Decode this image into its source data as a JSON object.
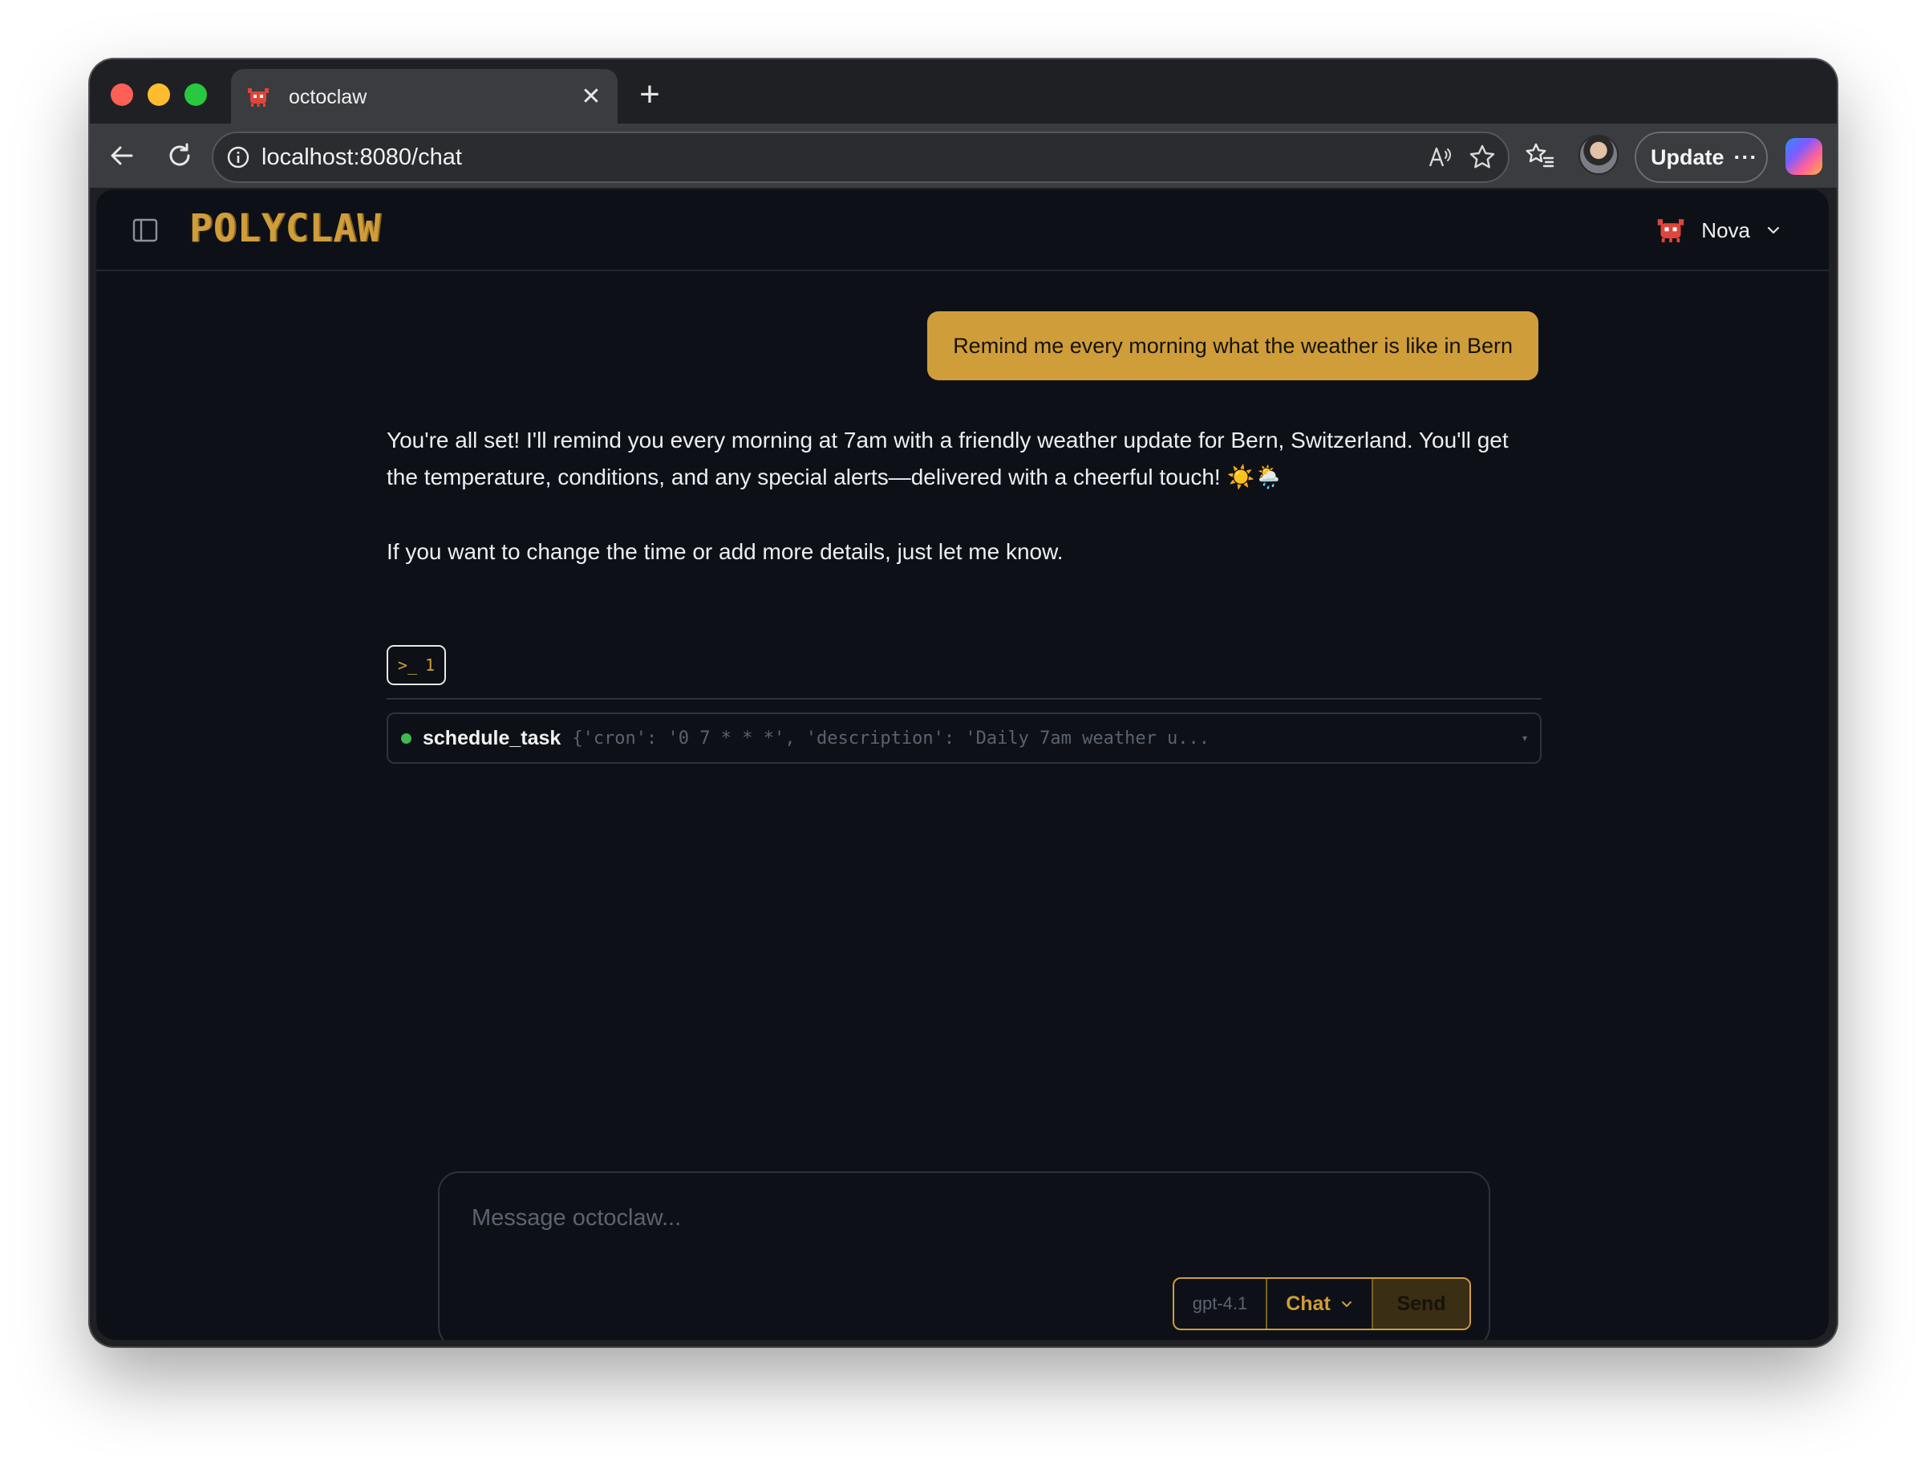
{
  "browser": {
    "tab_title": "octoclaw",
    "url": "localhost:8080/chat",
    "update_label": "Update",
    "icons": [
      "octoclaw-favicon",
      "close-icon",
      "plus-icon",
      "back-arrow-icon",
      "reload-icon",
      "site-info-icon",
      "read-aloud-icon",
      "star-icon",
      "favorites-icon",
      "profile-avatar",
      "more-icon",
      "copilot-icon"
    ]
  },
  "app": {
    "logo_text": "POLYCLAW",
    "agent_name": "Nova",
    "accent_color": "#cf9d3a",
    "background_color": "#0d1117"
  },
  "chat": {
    "user_message": "Remind me every morning what the weather is like in Bern",
    "assistant_paragraphs": [
      "You're all set! I'll remind you every morning at 7am with a friendly weather update for Bern, Switzerland. You'll get the temperature, conditions, and any special alerts—delivered with a cheerful touch! ☀️🌦️",
      "If you want to change the time or add more details, just let me know."
    ],
    "tool_badge": {
      "prompt_glyph": ">_",
      "count": "1"
    },
    "tool_call": {
      "name": "schedule_task",
      "args_preview": "{'cron': '0 7 * * *', 'description': 'Daily 7am weather u...",
      "status": "success",
      "status_color": "#3fb950"
    }
  },
  "composer": {
    "placeholder": "Message octoclaw...",
    "model": "gpt-4.1",
    "mode": "Chat",
    "send_label": "Send"
  }
}
